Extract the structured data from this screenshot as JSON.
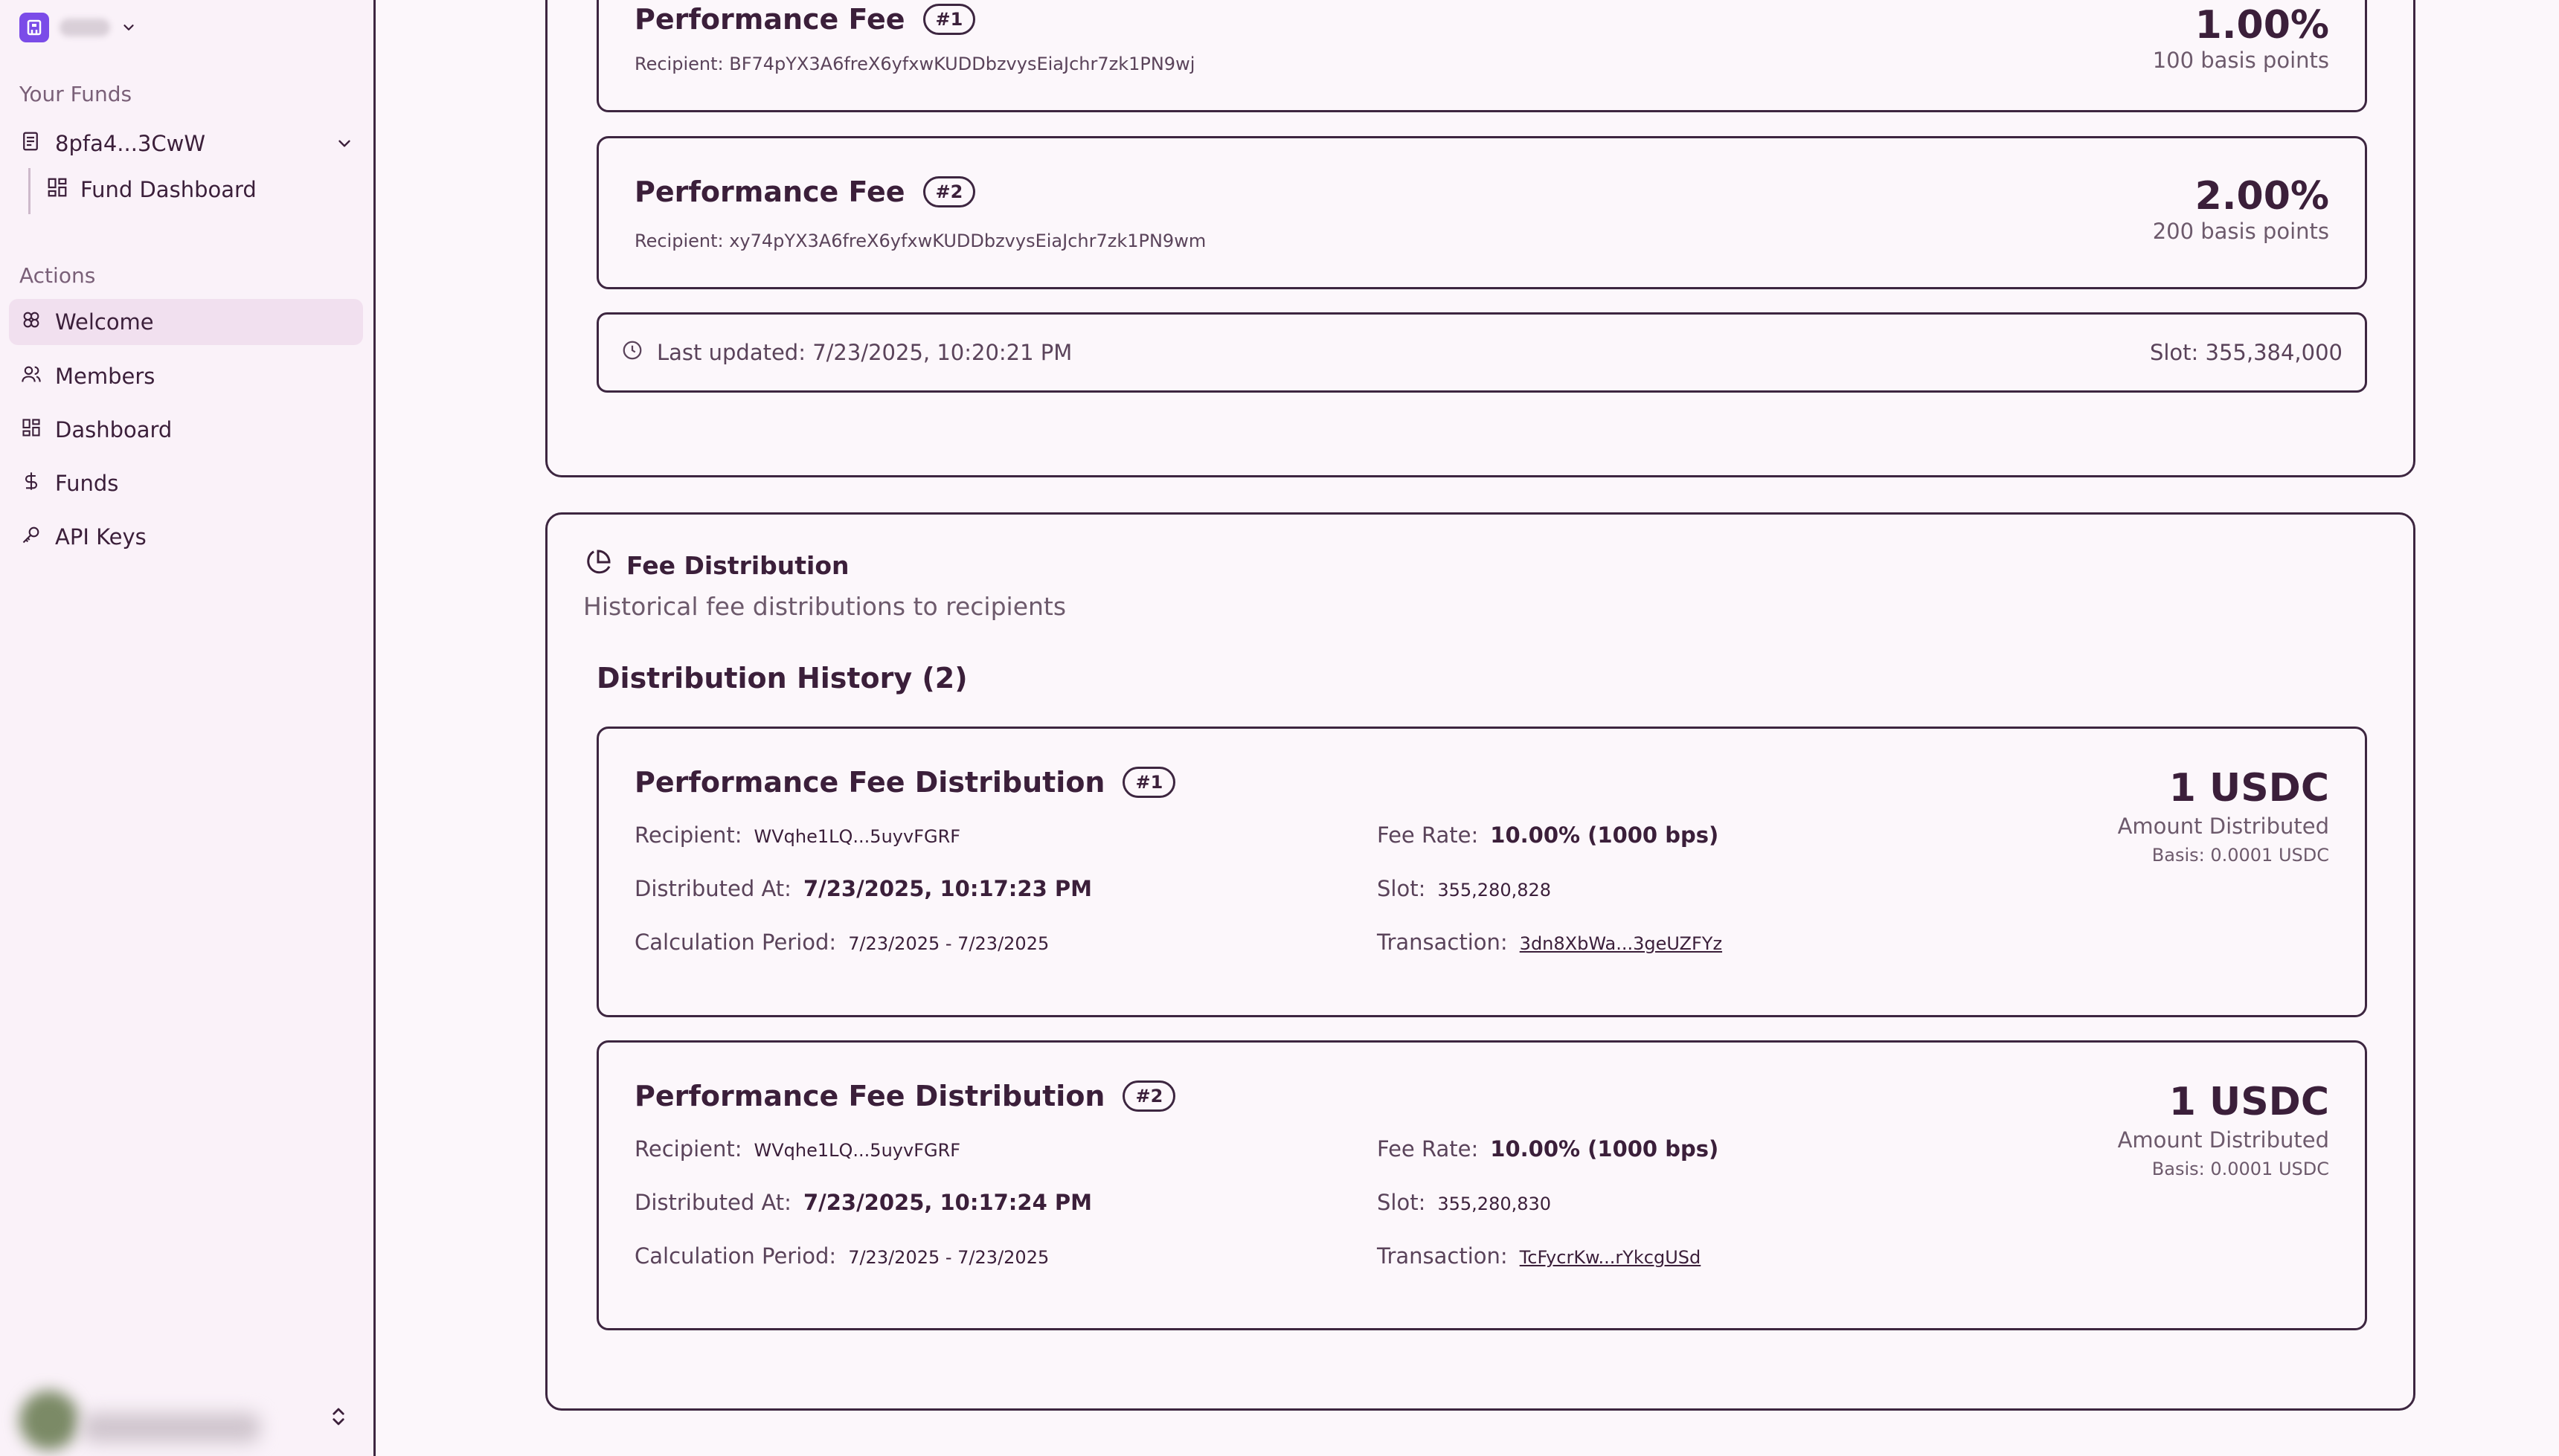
{
  "sidebar": {
    "your_funds_label": "Your Funds",
    "fund_name": "8pfa4...3CwW",
    "sub_item": "Fund Dashboard",
    "actions_label": "Actions",
    "nav": [
      {
        "label": "Welcome",
        "icon": "flower-icon",
        "active": true
      },
      {
        "label": "Members",
        "icon": "users-icon",
        "active": false
      },
      {
        "label": "Dashboard",
        "icon": "grid-icon",
        "active": false
      },
      {
        "label": "Funds",
        "icon": "dollar-icon",
        "active": false
      },
      {
        "label": "API Keys",
        "icon": "key-icon",
        "active": false
      }
    ]
  },
  "fees": [
    {
      "title": "Performance Fee",
      "badge": "#1",
      "recipient": "Recipient: BF74pYX3A6freX6yfxwKUDDbzvysEiaJchr7zk1PN9wj",
      "percent": "1.00%",
      "bps": "100 basis points"
    },
    {
      "title": "Performance Fee",
      "badge": "#2",
      "recipient": "Recipient: xy74pYX3A6freX6yfxwKUDDbzvysEiaJchr7zk1PN9wm",
      "percent": "2.00%",
      "bps": "200 basis points"
    }
  ],
  "last_updated": {
    "text": "Last updated: 7/23/2025, 10:20:21 PM",
    "slot": "Slot: 355,384,000"
  },
  "distribution": {
    "title": "Fee Distribution",
    "subtitle": "Historical fee distributions to recipients",
    "history_heading": "Distribution History (2)",
    "labels": {
      "recipient": "Recipient:",
      "distributed_at": "Distributed At:",
      "calc_period": "Calculation Period:",
      "fee_rate": "Fee Rate:",
      "slot": "Slot:",
      "transaction": "Transaction:",
      "amount_distributed": "Amount Distributed"
    },
    "items": [
      {
        "title": "Performance Fee Distribution",
        "badge": "#1",
        "recipient": "WVqhe1LQ...5uyvFGRF",
        "distributed_at": "7/23/2025, 10:17:23 PM",
        "calc_period": "7/23/2025 - 7/23/2025",
        "fee_rate": "10.00% (1000 bps)",
        "slot": "355,280,828",
        "transaction": "3dn8XbWa...3geUZFYz",
        "amount": "1 USDC",
        "basis": "Basis: 0.0001 USDC"
      },
      {
        "title": "Performance Fee Distribution",
        "badge": "#2",
        "recipient": "WVqhe1LQ...5uyvFGRF",
        "distributed_at": "7/23/2025, 10:17:24 PM",
        "calc_period": "7/23/2025 - 7/23/2025",
        "fee_rate": "10.00% (1000 bps)",
        "slot": "355,280,830",
        "transaction": "TcFycrKw...rYkcgUSd",
        "amount": "1 USDC",
        "basis": "Basis: 0.0001 USDC"
      }
    ]
  },
  "colors": {
    "accent": "#7b4ce8",
    "text": "#3b1f3a",
    "border": "#3d2640",
    "active_bg": "#f1e0ef"
  }
}
